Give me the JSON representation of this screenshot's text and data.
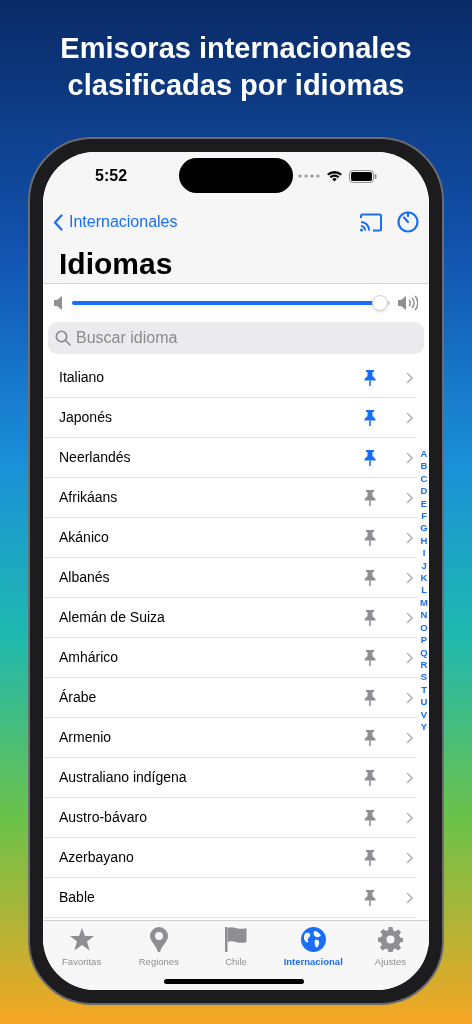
{
  "headline": "Emisoras internacionales clasificadas por idiomas",
  "status_bar": {
    "time": "5:52"
  },
  "nav": {
    "back": "Internacionales",
    "title": "Idiomas"
  },
  "volume": {
    "level": 0.97
  },
  "search": {
    "placeholder": "Buscar idioma"
  },
  "languages": [
    {
      "name": "Italiano",
      "pinned": true
    },
    {
      "name": "Japonés",
      "pinned": true
    },
    {
      "name": "Neerlandés",
      "pinned": true
    },
    {
      "name": "Afrikáans",
      "pinned": false
    },
    {
      "name": "Akánico",
      "pinned": false
    },
    {
      "name": "Albanés",
      "pinned": false
    },
    {
      "name": "Alemán de Suiza",
      "pinned": false
    },
    {
      "name": "Amhárico",
      "pinned": false
    },
    {
      "name": "Árabe",
      "pinned": false
    },
    {
      "name": "Armenio",
      "pinned": false
    },
    {
      "name": "Australiano indígena",
      "pinned": false
    },
    {
      "name": "Austro-bávaro",
      "pinned": false
    },
    {
      "name": "Azerbayano",
      "pinned": false
    },
    {
      "name": "Bable",
      "pinned": false
    }
  ],
  "index": [
    "A",
    "B",
    "C",
    "D",
    "E",
    "F",
    "G",
    "H",
    "I",
    "J",
    "K",
    "L",
    "M",
    "N",
    "O",
    "P",
    "Q",
    "R",
    "S",
    "T",
    "U",
    "V",
    "Y"
  ],
  "tabs": [
    {
      "label": "Favoritas",
      "kind": "star",
      "selected": false
    },
    {
      "label": "Regiones",
      "kind": "pin",
      "selected": false
    },
    {
      "label": "Chile",
      "kind": "flag",
      "selected": false
    },
    {
      "label": "Internacional",
      "kind": "globe",
      "selected": true
    },
    {
      "label": "Ajustes",
      "kind": "gear",
      "selected": false
    }
  ]
}
